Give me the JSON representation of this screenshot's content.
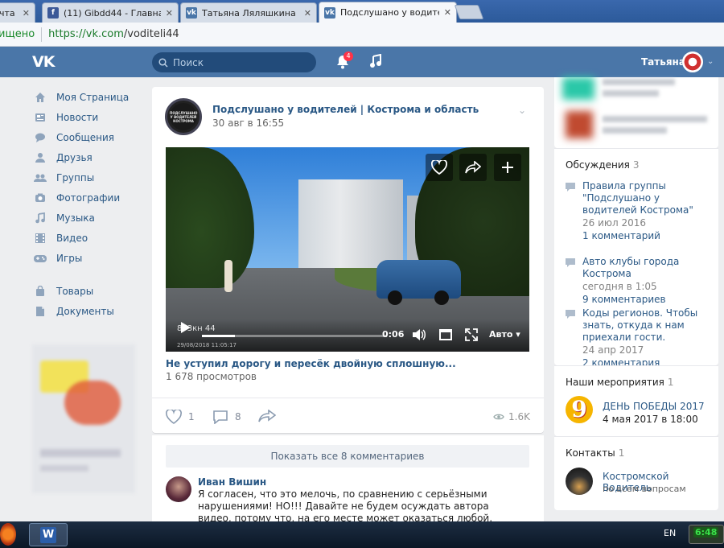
{
  "browser": {
    "tabs": [
      {
        "label": "чта М",
        "icon": "mail-icon",
        "active": false
      },
      {
        "label": "(11) Gibdd44 - Главная",
        "icon": "facebook-icon",
        "active": false
      },
      {
        "label": "Татьяна Ляляшкина",
        "icon": "vk-icon",
        "active": false
      },
      {
        "label": "Подслушано у водителе",
        "icon": "vk-icon",
        "active": true
      }
    ],
    "address": {
      "secure_label": "ищено",
      "url_host": "https://vk.com",
      "url_path": "/voditeli44"
    }
  },
  "header": {
    "logo": "VK",
    "search_placeholder": "Поиск",
    "notifications_count": "4",
    "user_name": "Татьяна"
  },
  "sidebar": {
    "items": [
      {
        "label": "Моя Страница",
        "icon": "home-icon"
      },
      {
        "label": "Новости",
        "icon": "news-icon"
      },
      {
        "label": "Сообщения",
        "icon": "messages-icon"
      },
      {
        "label": "Друзья",
        "icon": "friends-icon"
      },
      {
        "label": "Группы",
        "icon": "groups-icon"
      },
      {
        "label": "Фотографии",
        "icon": "camera-icon"
      },
      {
        "label": "Музыка",
        "icon": "music-icon"
      },
      {
        "label": "Видео",
        "icon": "video-icon"
      },
      {
        "label": "Игры",
        "icon": "gamepad-icon"
      }
    ],
    "items2": [
      {
        "label": "Товары",
        "icon": "bag-icon"
      },
      {
        "label": "Документы",
        "icon": "document-icon"
      }
    ]
  },
  "post": {
    "group_name": "Подслушано у водителей | Кострома и область",
    "date": "30 авг в 16:55",
    "avatar_text": "ПОДСЛУШАНО У ВОДИТЕЛЕЙ КОСТРОМА",
    "video": {
      "time": "0:06",
      "quality": "Авто",
      "plate": "873кн 44",
      "stamp": "29/08/2018 11:05:17",
      "progress": 0.18
    },
    "video_title": "Не уступил дорогу и пересёк двойную сплошную...",
    "views": "1 678 просмотров",
    "likes": "1",
    "comments": "8",
    "view_count": "1.6K"
  },
  "comments": {
    "show_all": "Показать все 8 комментариев",
    "author": "Иван Вишин",
    "text": "Я согласен, что это мелочь, по сравнению с серьёзными нарушениями! НО!!! Давайте не будем осуждать автора видео, потому что, на его месте может оказаться любой, здесь облививший грязью! Я, например, всегда"
  },
  "right": {
    "discussions": {
      "title": "Обсуждения",
      "count": "3",
      "items": [
        {
          "title": "Правила группы \"Подслушано у водителей Кострома\"",
          "date": "26 июл 2016",
          "comments": "1 комментарий"
        },
        {
          "title": "Авто клубы города Кострома",
          "date": "сегодня в 1:05",
          "comments": "9 комментариев"
        },
        {
          "title": "Коды регионов. Чтобы знать, откуда к нам приехали гости.",
          "date": "24 апр 2017",
          "comments": "2 комментария"
        }
      ]
    },
    "events": {
      "title": "Наши мероприятия",
      "count": "1",
      "event_title": "ДЕНЬ ПОБЕДЫ 2017",
      "event_date": "4 мая 2017 в 18:00",
      "event_icon_text": "9"
    },
    "contacts": {
      "title": "Контакты",
      "count": "1",
      "name": "Костромской Водитель",
      "role": "по всем вопросам"
    }
  },
  "taskbar": {
    "lang": "EN",
    "battery": "6:48",
    "word_letter": "W"
  }
}
